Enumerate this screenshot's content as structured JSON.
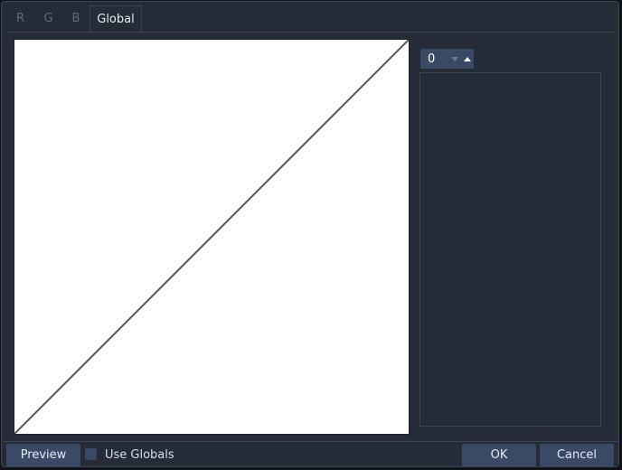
{
  "tabs": {
    "r": "R",
    "g": "G",
    "b": "B",
    "global": "Global"
  },
  "spinner": {
    "value": "0"
  },
  "footer": {
    "preview": "Preview",
    "use_globals": "Use Globals",
    "ok": "OK",
    "cancel": "Cancel"
  },
  "icons": {
    "spin_down": "down-arrow-icon",
    "spin_up": "up-arrow-icon"
  },
  "colors": {
    "background": "#262c37",
    "accent": "#3a4a66",
    "curve": "#555555"
  }
}
